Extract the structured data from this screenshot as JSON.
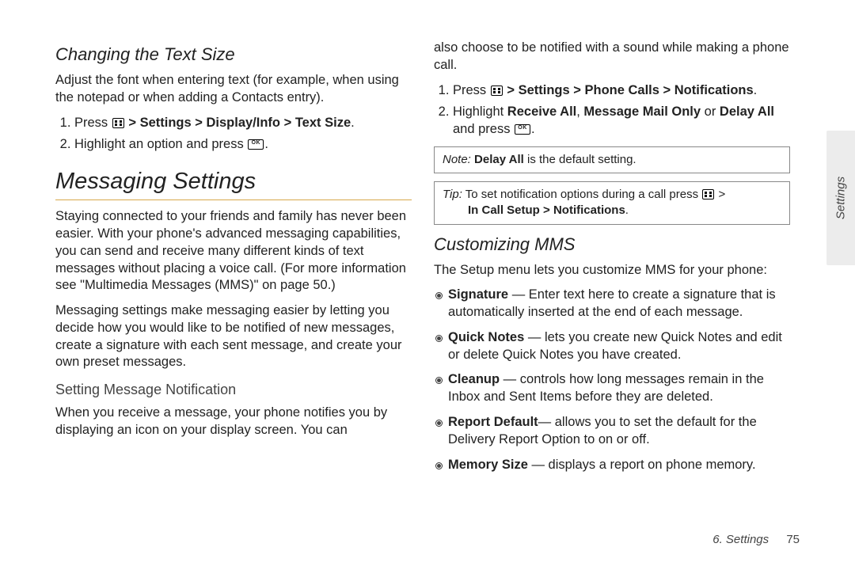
{
  "left": {
    "h2_changing": "Changing the Text Size",
    "p_adjust": "Adjust the font when entering text (for example, when using the notepad or when adding a Contacts entry).",
    "step1_press": "Press ",
    "step1_gt": " > ",
    "step1_settings": "Settings",
    "step1_display": "Display/Info",
    "step1_textsize": "Text Size",
    "step1_end": ".",
    "step2_hl": "Highlight an option and press ",
    "step2_end": ".",
    "h1_messaging": "Messaging Settings",
    "p_staying": "Staying connected to your friends and family has never been easier. With your phone's advanced messaging capabilities, you can send and receive many different kinds of text messages without placing a voice call. (For more information see \"Multimedia Messages (MMS)\" on page 50.)",
    "p_msgset": "Messaging settings make messaging easier by letting you decide how you would like to be notified of new messages, create a signature with each sent message, and create your own preset messages.",
    "h3_setnotif": "Setting Message Notification",
    "p_when": "When you receive a message, your phone notifies you by displaying an icon on your display screen. You can"
  },
  "right": {
    "p_also": "also choose to be notified with a sound while making a phone call.",
    "r_step1_press": "Press ",
    "r_step1_gt": " > ",
    "r_step1_settings": "Settings",
    "r_step1_phone": "Phone Calls",
    "r_step1_notif": "Notifications",
    "r_step1_end": ".",
    "r_step2_hl": "Highlight ",
    "r_step2_recv": "Receive All",
    "r_step2_comma": ", ",
    "r_step2_mmo": "Message Mail Only",
    "r_step2_or": " or ",
    "r_step2_delay": "Delay All",
    "r_step2_and": " and press ",
    "r_step2_end": ".",
    "note_label": "Note:",
    "note_pre": " ",
    "note_bold": "Delay All",
    "note_post": " is the default setting.",
    "tip_label": "Tip:",
    "tip_pre": " To set notification options during a call press ",
    "tip_gt": " > ",
    "tip_incall": "In Call Setup",
    "tip_notif": "Notifications",
    "tip_end": ".",
    "h2_cust": "Customizing MMS",
    "p_setup": "The Setup menu lets you customize MMS for your phone:",
    "b_sig_t": "Signature",
    "b_sig_d": " — Enter text here to create a signature that is automatically inserted at the end of each message.",
    "b_qn_t": "Quick Notes",
    "b_qn_d": " — lets you create new Quick Notes and edit or delete Quick Notes you have created.",
    "b_cl_t": "Cleanup",
    "b_cl_d": " — controls how long messages remain in the Inbox and Sent Items before they are deleted.",
    "b_rd_t": "Report Default",
    "b_rd_d": "— allows you to set the default for the Delivery Report Option to on or off.",
    "b_ms_t": "Memory Size",
    "b_ms_d": " — displays a report on phone memory."
  },
  "side_tab": "Settings",
  "footer_section": "6. Settings",
  "footer_page": "75"
}
